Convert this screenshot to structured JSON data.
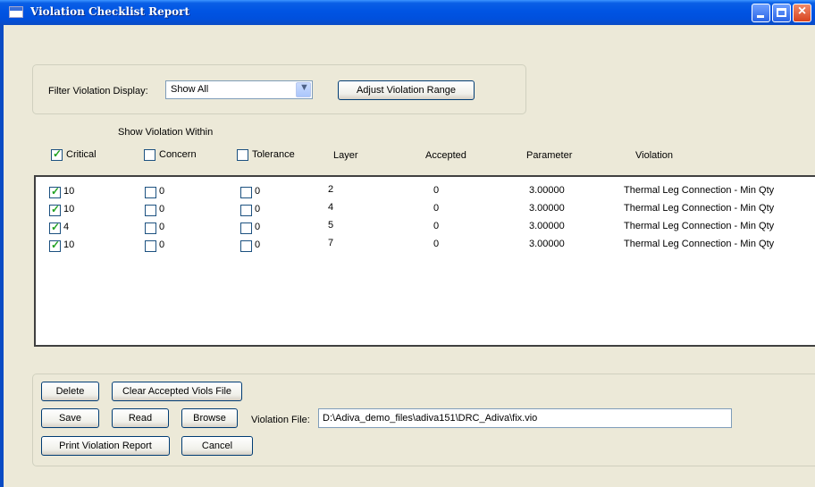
{
  "window": {
    "title": "Violation Checklist  Report"
  },
  "filter": {
    "label": "Filter Violation Display:",
    "selected": "Show All",
    "adjust_button": "Adjust Violation Range"
  },
  "header": {
    "show_within": "Show Violation Within",
    "critical": "Critical",
    "concern": "Concern",
    "tolerance": "Tolerance",
    "layer": "Layer",
    "accepted": "Accepted",
    "parameter": "Parameter",
    "violation": "Violation"
  },
  "rows": [
    {
      "critical": "10",
      "concern": "0",
      "tolerance": "0",
      "layer": "2",
      "accepted": "0",
      "parameter": "3.00000",
      "violation": "Thermal Leg Connection - Min Qty"
    },
    {
      "critical": "10",
      "concern": "0",
      "tolerance": "0",
      "layer": "4",
      "accepted": "0",
      "parameter": "3.00000",
      "violation": "Thermal Leg Connection - Min Qty"
    },
    {
      "critical": "4",
      "concern": "0",
      "tolerance": "0",
      "layer": "5",
      "accepted": "0",
      "parameter": "3.00000",
      "violation": "Thermal Leg Connection - Min Qty"
    },
    {
      "critical": "10",
      "concern": "0",
      "tolerance": "0",
      "layer": "7",
      "accepted": "0",
      "parameter": "3.00000",
      "violation": "Thermal Leg Connection - Min Qty"
    }
  ],
  "actions": {
    "delete": "Delete",
    "clear_accepted": "Clear Accepted Viols File",
    "save": "Save",
    "read": "Read",
    "browse": "Browse",
    "violation_file_label": "Violation File:",
    "violation_file_value": "D:\\Adiva_demo_files\\adiva151\\DRC_Adiva\\fix.vio",
    "print_report": "Print Violation Report",
    "cancel": "Cancel"
  }
}
